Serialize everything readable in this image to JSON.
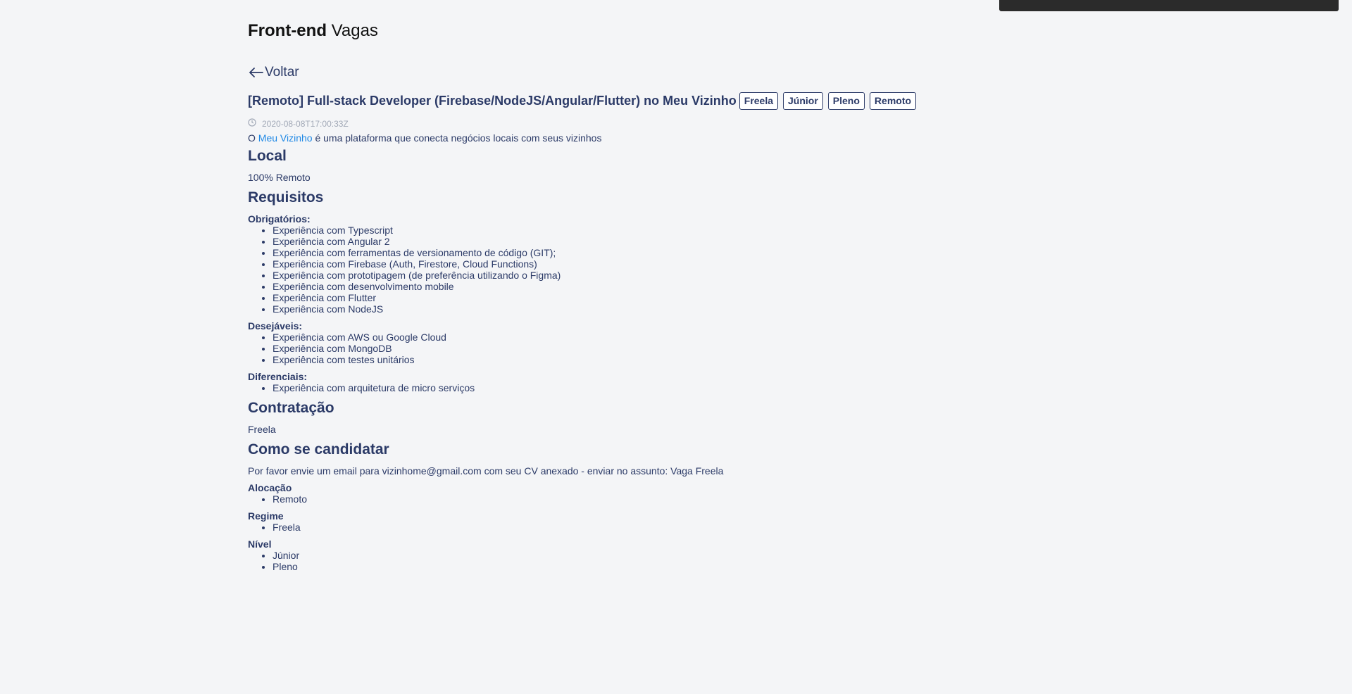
{
  "brand": {
    "bold": "Front-end",
    "light": "Vagas"
  },
  "back": {
    "label": "Voltar"
  },
  "job": {
    "title": "[Remoto] Full-stack Developer (Firebase/NodeJS/Angular/Flutter) no Meu Vizinho",
    "tags": [
      "Freela",
      "Júnior",
      "Pleno",
      "Remoto"
    ],
    "date": "2020-08-08T17:00:33Z"
  },
  "intro": {
    "prefix": "O ",
    "link": "Meu Vizinho",
    "suffix": " é uma plataforma que conecta negócios locais com seus vizinhos"
  },
  "local": {
    "heading": "Local",
    "text": "100% Remoto"
  },
  "requisitos": {
    "heading": "Requisitos",
    "obrigatorios": {
      "label": "Obrigatórios:",
      "items": [
        "Experiência com Typescript",
        "Experiência com Angular 2",
        "Experiência com ferramentas de versionamento de código (GIT);",
        "Experiência com Firebase (Auth, Firestore, Cloud Functions)",
        "Experiência com prototipagem (de preferência utilizando o Figma)",
        "Experiência com desenvolvimento mobile",
        "Experiência com Flutter",
        "Experiência com NodeJS"
      ]
    },
    "desejaveis": {
      "label": "Desejáveis:",
      "items": [
        "Experiência com AWS ou Google Cloud",
        "Experiência com MongoDB",
        "Experiência com testes unitários"
      ]
    },
    "diferenciais": {
      "label": "Diferenciais:",
      "items": [
        "Experiência com arquitetura de micro serviços"
      ]
    }
  },
  "contratacao": {
    "heading": "Contratação",
    "text": "Freela"
  },
  "candidatar": {
    "heading": "Como se candidatar",
    "text": "Por favor envie um email para vizinhome@gmail.com com seu CV anexado - enviar no assunto: Vaga Freela"
  },
  "alocacao": {
    "label": "Alocação",
    "items": [
      "Remoto"
    ]
  },
  "regime": {
    "label": "Regime",
    "items": [
      "Freela"
    ]
  },
  "nivel": {
    "label": "Nível",
    "items": [
      "Júnior",
      "Pleno"
    ]
  }
}
